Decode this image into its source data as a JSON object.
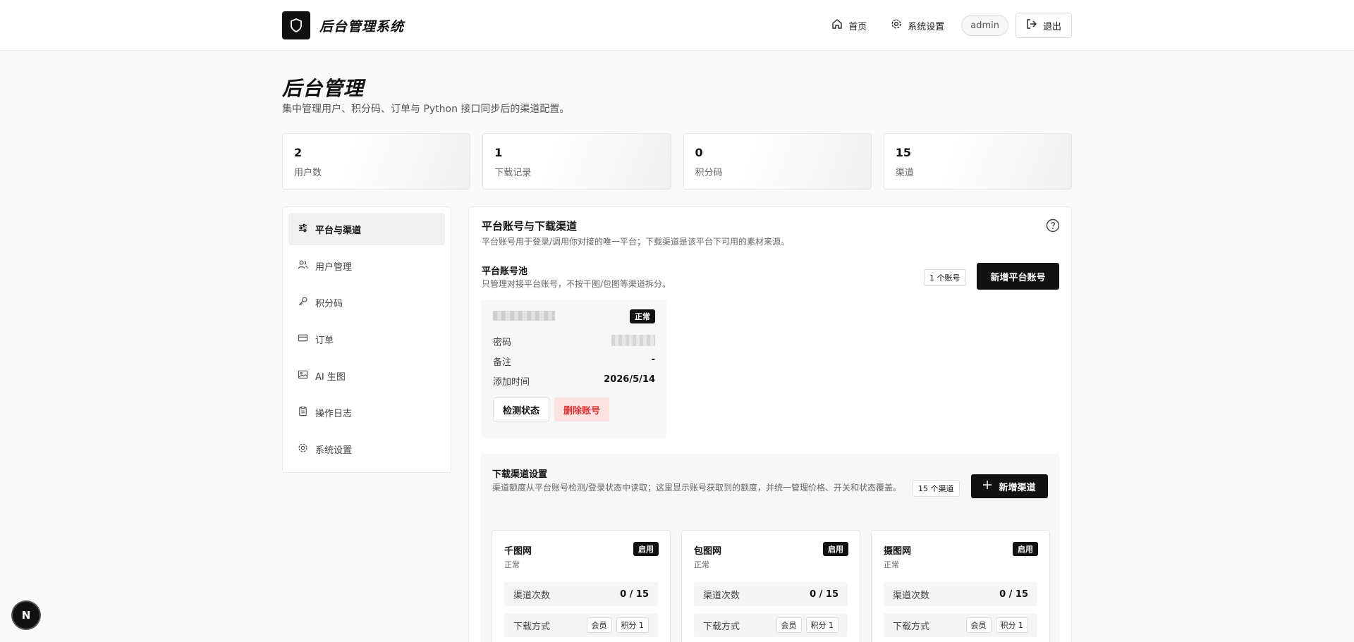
{
  "header": {
    "app_title": "后台管理系统",
    "nav": [
      {
        "label": "首页",
        "icon": "home-icon"
      },
      {
        "label": "系统设置",
        "icon": "gear-icon"
      }
    ],
    "user": "admin",
    "logout_label": "退出"
  },
  "page": {
    "title": "后台管理",
    "subtitle": "集中管理用户、积分码、订单与 Python 接口同步后的渠道配置。"
  },
  "stats": [
    {
      "value": "2",
      "label": "用户数"
    },
    {
      "value": "1",
      "label": "下载记录"
    },
    {
      "value": "0",
      "label": "积分码"
    },
    {
      "value": "15",
      "label": "渠道"
    }
  ],
  "sidebar": {
    "items": [
      {
        "label": "平台与渠道",
        "icon": "sliders-icon",
        "active": true
      },
      {
        "label": "用户管理",
        "icon": "users-icon"
      },
      {
        "label": "积分码",
        "icon": "key-icon"
      },
      {
        "label": "订单",
        "icon": "card-icon"
      },
      {
        "label": "AI 生图",
        "icon": "image-icon"
      },
      {
        "label": "操作日志",
        "icon": "clipboard-icon"
      },
      {
        "label": "系统设置",
        "icon": "gear-icon"
      }
    ]
  },
  "main": {
    "title": "平台账号与下载渠道",
    "desc": "平台账号用于登录/调用你对接的唯一平台；下载渠道是该平台下可用的素材来源。",
    "pool": {
      "title": "平台账号池",
      "desc": "只管理对接平台账号，不按千图/包图等渠道拆分。",
      "count": "1 个账号",
      "add_label": "新增平台账号"
    },
    "account": {
      "status": "正常",
      "rows": [
        {
          "label": "密码",
          "value": ""
        },
        {
          "label": "备注",
          "value": "-"
        },
        {
          "label": "添加时间",
          "value": "2026/5/14"
        }
      ],
      "check_label": "检测状态",
      "delete_label": "删除账号"
    },
    "download": {
      "title": "下载渠道设置",
      "desc": "渠道额度从平台账号检测/登录状态中读取；这里显示账号获取到的额度，并统一管理价格、开关和状态覆盖。",
      "count": "15 个渠道",
      "add_label": "新增渠道",
      "channels": [
        {
          "name": "千图网",
          "tag": "启用",
          "status": "正常",
          "quota_label": "渠道次数",
          "quota": "0 / 15",
          "method_label": "下载方式",
          "methods": [
            "会员",
            "积分 1"
          ]
        },
        {
          "name": "包图网",
          "tag": "启用",
          "status": "正常",
          "quota_label": "渠道次数",
          "quota": "0 / 15",
          "method_label": "下载方式",
          "methods": [
            "会员",
            "积分 1"
          ]
        },
        {
          "name": "摄图网",
          "tag": "启用",
          "status": "正常",
          "quota_label": "渠道次数",
          "quota": "0 / 15",
          "method_label": "下载方式",
          "methods": [
            "会员",
            "积分 1"
          ]
        }
      ]
    }
  },
  "floating_badge": "N"
}
